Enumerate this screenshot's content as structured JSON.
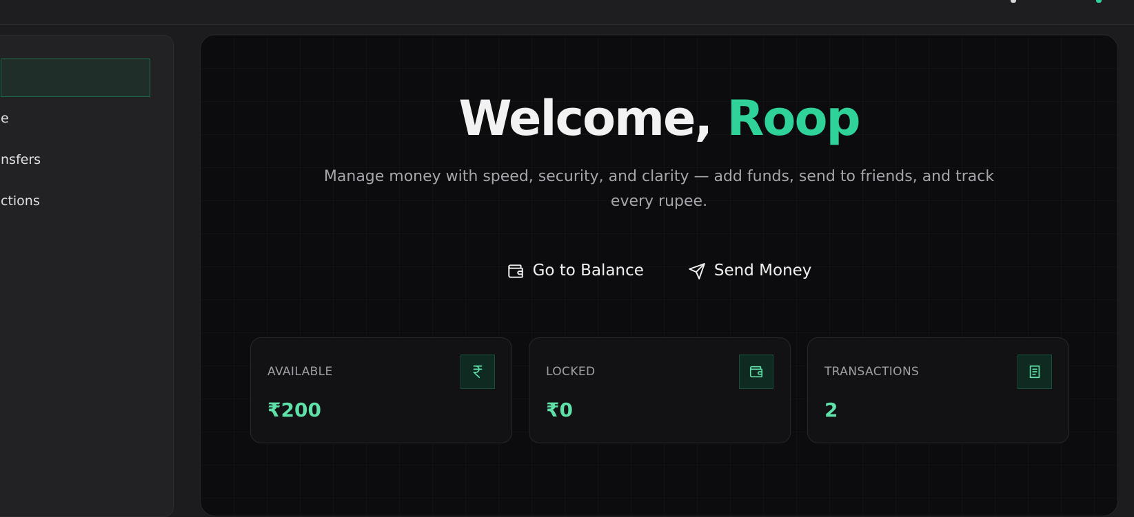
{
  "sidebar": {
    "items": [
      {
        "label": "",
        "active": true
      },
      {
        "label": "e",
        "active": false
      },
      {
        "label": "nsfers",
        "active": false
      },
      {
        "label": "ctions",
        "active": false
      }
    ]
  },
  "hero": {
    "title_prefix": "Welcome,",
    "title_name": "Roop",
    "subtitle": "Manage money with speed, security, and clarity — add funds, send to friends, and track every rupee.",
    "actions": [
      {
        "label": "Go to Balance",
        "icon": "wallet-icon"
      },
      {
        "label": "Send Money",
        "icon": "send-icon"
      }
    ]
  },
  "stats": [
    {
      "label": "AVAILABLE",
      "value": "₹200",
      "icon": "rupee-icon"
    },
    {
      "label": "LOCKED",
      "value": "₹0",
      "icon": "wallet-icon"
    },
    {
      "label": "TRANSACTIONS",
      "value": "2",
      "icon": "receipt-icon"
    }
  ],
  "colors": {
    "accent": "#2fd39a",
    "accent_value": "#5fe0a8",
    "background": "#0c0c0e"
  }
}
